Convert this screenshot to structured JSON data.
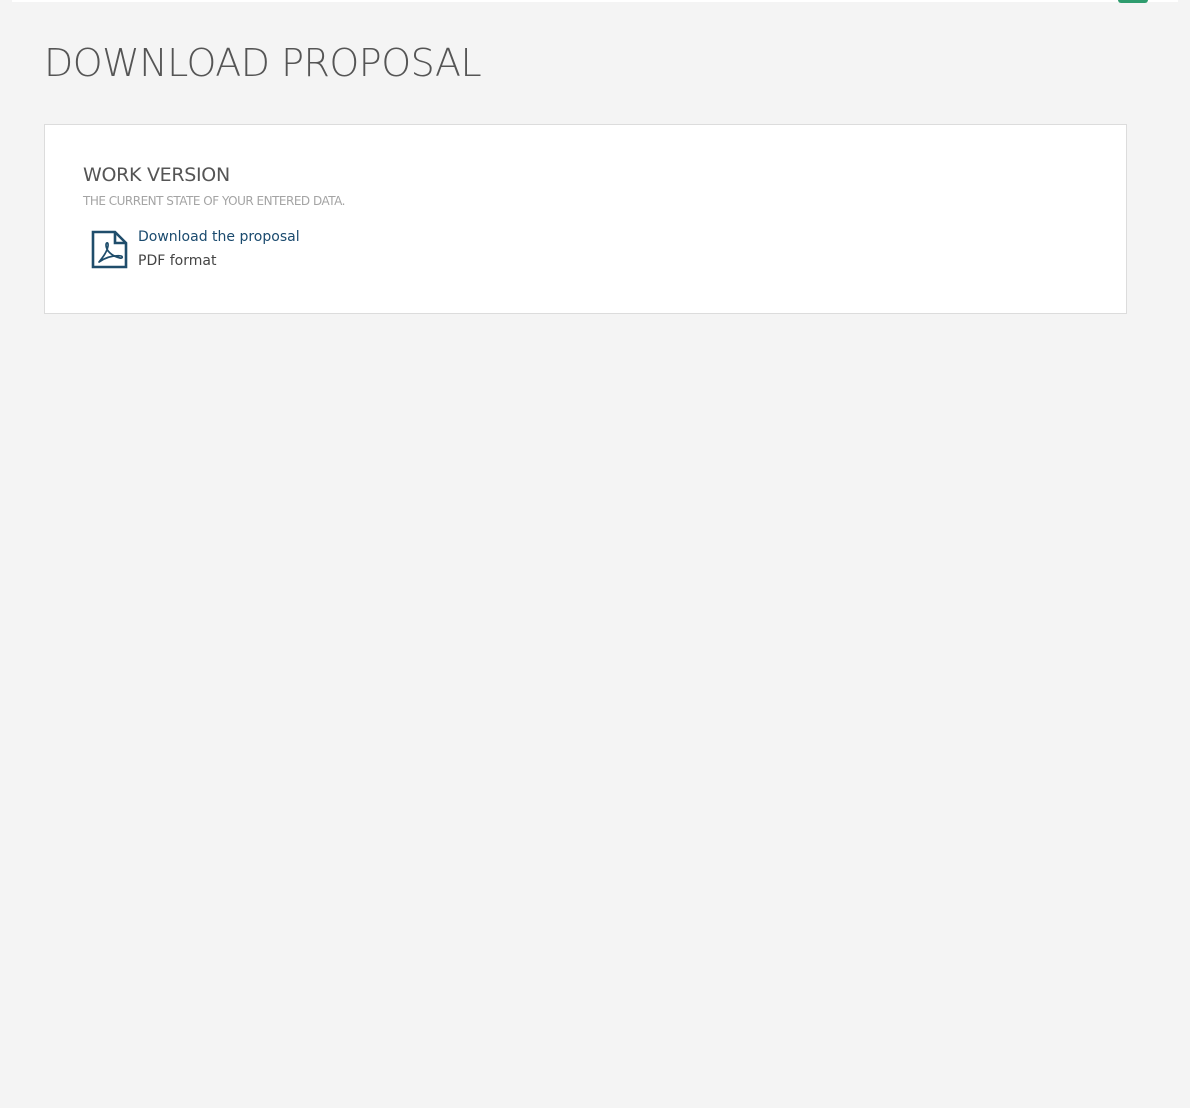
{
  "page": {
    "title": "DOWNLOAD PROPOSAL"
  },
  "work_version": {
    "title": "WORK VERSION",
    "subtitle": "THE CURRENT STATE OF YOUR ENTERED DATA.",
    "download": {
      "icon": "pdf-file-icon",
      "label": "Download the proposal",
      "format": "PDF format"
    }
  },
  "colors": {
    "background": "#f4f4f4",
    "card": "#ffffff",
    "link": "#1a4a6e",
    "icon": "#1f4d6b",
    "accent": "#2e9c6e"
  }
}
